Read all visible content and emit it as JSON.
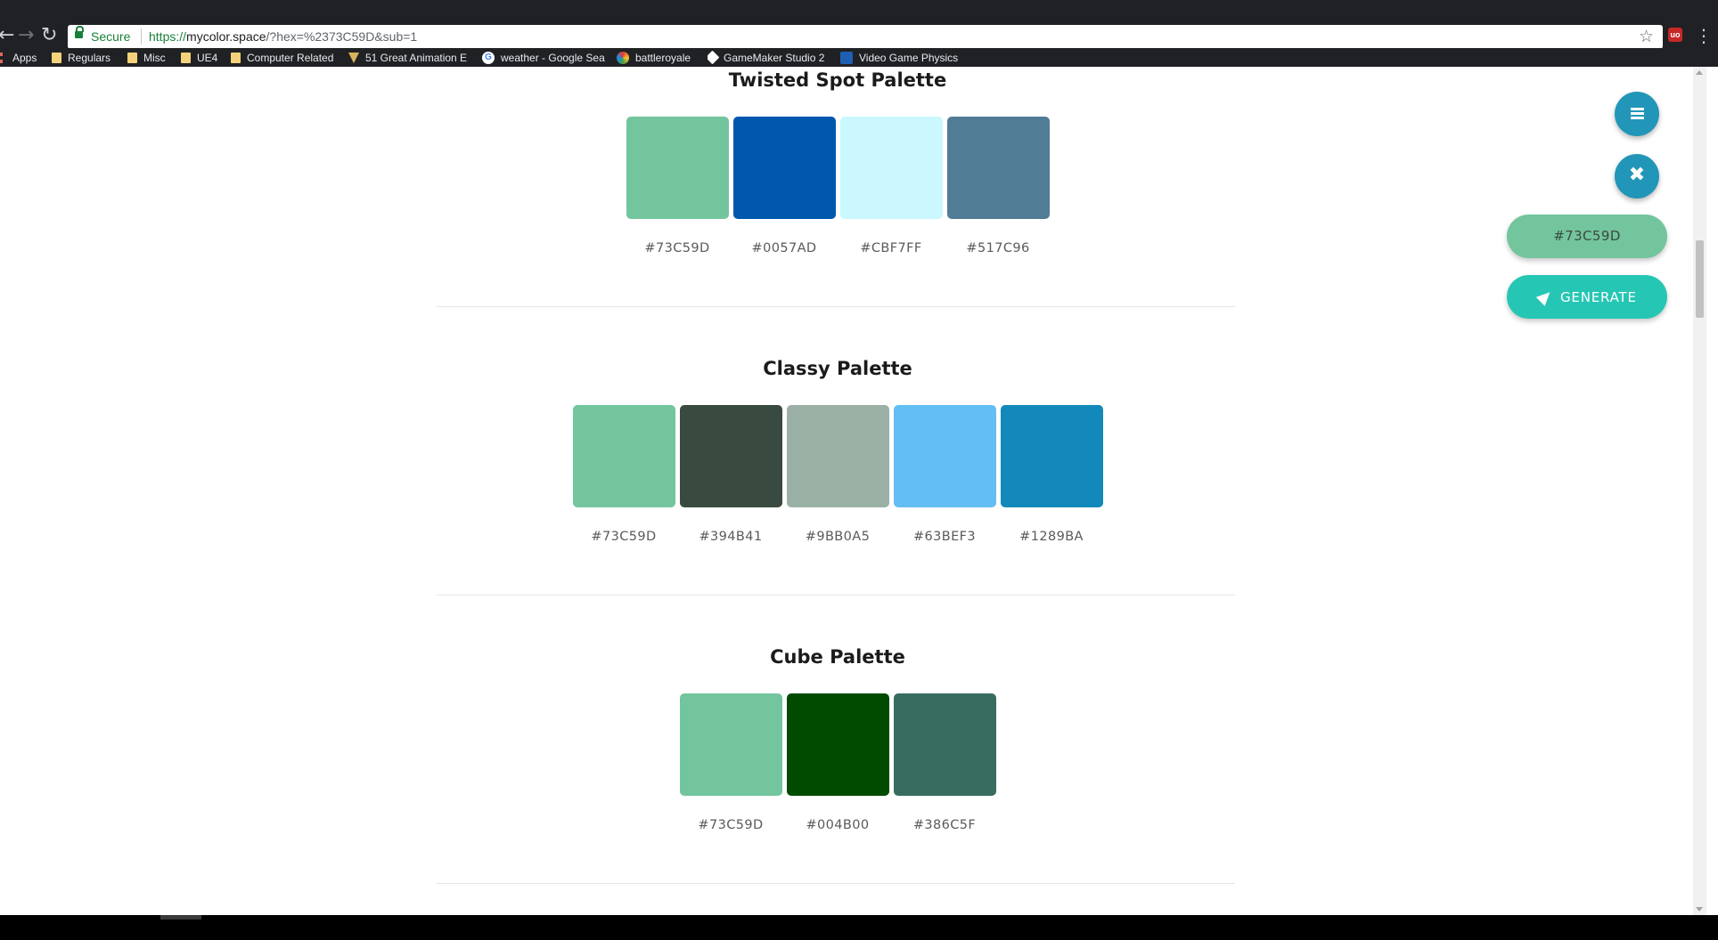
{
  "browser": {
    "secure_label": "Secure",
    "url_scheme": "https://",
    "url_host": "mycolor.space",
    "url_rest": "/?hex=%2373C59D&sub=1",
    "bookmarks": [
      "Apps",
      "Regulars",
      "Misc",
      "UE4",
      "Computer Related",
      "51 Great Animation E",
      "weather - Google Sea",
      "battleroyale",
      "GameMaker Studio 2",
      "Video Game Physics"
    ]
  },
  "palettes": [
    {
      "title": "Twisted Spot Palette",
      "colors": [
        "#73C59D",
        "#0057AD",
        "#CBF7FF",
        "#517C96"
      ]
    },
    {
      "title": "Classy Palette",
      "colors": [
        "#73C59D",
        "#394B41",
        "#9BB0A5",
        "#63BEF3",
        "#1289BA"
      ]
    },
    {
      "title": "Cube Palette",
      "colors": [
        "#73C59D",
        "#004B00",
        "#386C5F"
      ]
    }
  ],
  "controls": {
    "current_color": "#73C59D",
    "generate_label": "GENERATE",
    "menu_icon": "hamburger-icon",
    "close_icon": "close-icon",
    "generate_icon": "rocket-icon"
  }
}
